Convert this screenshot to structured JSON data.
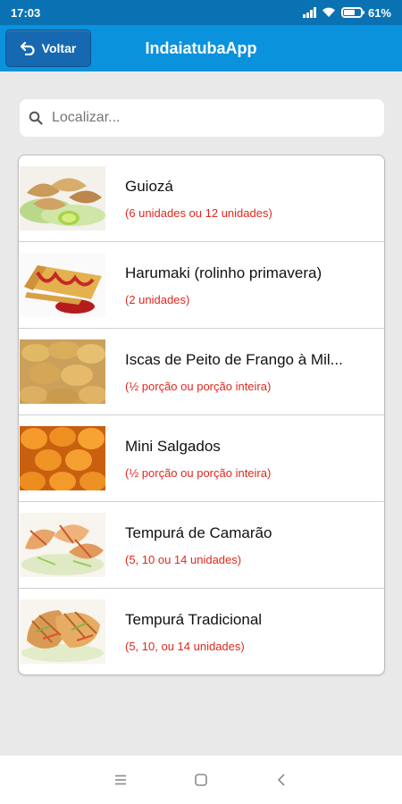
{
  "status": {
    "time": "17:03",
    "battery": "61%",
    "battery_level": 0.61
  },
  "header": {
    "back_label": "Voltar",
    "title": "IndaiatubaApp"
  },
  "search": {
    "placeholder": "Localizar..."
  },
  "items": [
    {
      "name": "Guiozá",
      "detail": "(6 unidades ou 12 unidades)",
      "thumb": "guioza-image"
    },
    {
      "name": "Harumaki (rolinho primavera)",
      "detail": "(2 unidades)",
      "thumb": "harumaki-image"
    },
    {
      "name": "Iscas de Peito de Frango à Mil...",
      "detail": "(½ porção ou porção inteira)",
      "thumb": "iscas-frango-image"
    },
    {
      "name": "Mini Salgados",
      "detail": "(½ porção ou porção inteira)",
      "thumb": "mini-salgados-image"
    },
    {
      "name": "Tempurá de Camarão",
      "detail": "(5, 10 ou 14 unidades)",
      "thumb": "tempura-camarao-image"
    },
    {
      "name": "Tempurá Tradicional",
      "detail": "(5, 10, ou 14 unidades)",
      "thumb": "tempura-tradicional-image"
    }
  ],
  "navbar": {
    "icons": [
      "menu-icon",
      "home-icon",
      "back-icon"
    ]
  },
  "colors": {
    "status_bar": "#0a72b3",
    "header": "#0b92dc",
    "back_button": "#1669b0",
    "detail_text": "#e0281e",
    "background": "#e9e9e9"
  }
}
